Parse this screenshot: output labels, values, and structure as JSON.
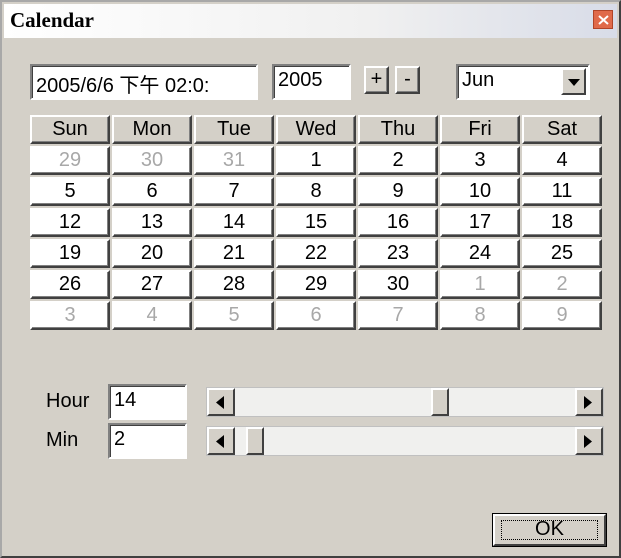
{
  "window": {
    "title": "Calendar"
  },
  "datetime_field": {
    "value": "2005/6/6 下午 02:0:"
  },
  "year_field": {
    "value": "2005"
  },
  "year_buttons": {
    "plus": "+",
    "minus": "-"
  },
  "month_select": {
    "value": "Jun"
  },
  "weekdays": [
    "Sun",
    "Mon",
    "Tue",
    "Wed",
    "Thu",
    "Fri",
    "Sat"
  ],
  "days": [
    [
      "29",
      "30",
      "31",
      "1",
      "2",
      "3",
      "4"
    ],
    [
      "5",
      "6",
      "7",
      "8",
      "9",
      "10",
      "11"
    ],
    [
      "12",
      "13",
      "14",
      "15",
      "16",
      "17",
      "18"
    ],
    [
      "19",
      "20",
      "21",
      "22",
      "23",
      "24",
      "25"
    ],
    [
      "26",
      "27",
      "28",
      "29",
      "30",
      "1",
      "2"
    ],
    [
      "3",
      "4",
      "5",
      "6",
      "7",
      "8",
      "9"
    ]
  ],
  "muted_days": [
    [
      0,
      0
    ],
    [
      0,
      1
    ],
    [
      0,
      2
    ],
    [
      4,
      5
    ],
    [
      4,
      6
    ],
    [
      5,
      0
    ],
    [
      5,
      1
    ],
    [
      5,
      2
    ],
    [
      5,
      3
    ],
    [
      5,
      4
    ],
    [
      5,
      5
    ],
    [
      5,
      6
    ]
  ],
  "hour": {
    "label": "Hour",
    "value": "14",
    "slider_fraction": 0.61
  },
  "min": {
    "label": "Min",
    "value": "2",
    "slider_fraction": 0.034
  },
  "ok_button": {
    "label": "OK"
  },
  "icons": {
    "close": "close-icon",
    "dropdown": "chevron-down-icon",
    "left": "arrow-left-icon",
    "right": "arrow-right-icon"
  }
}
